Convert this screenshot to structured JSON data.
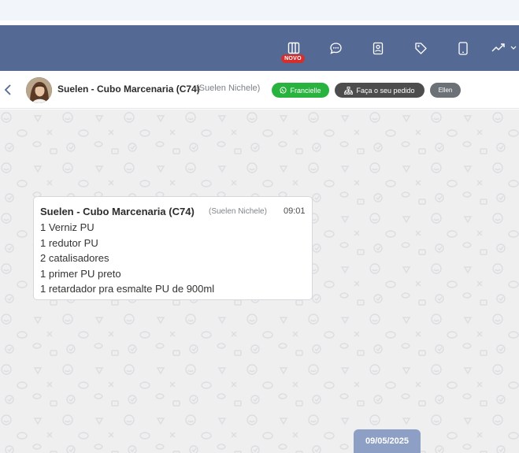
{
  "toolbar": {
    "icons": [
      "columns-icon",
      "chat-bubble-icon",
      "contact-book-icon",
      "tag-icon",
      "mobile-icon",
      "trending-up-icon",
      "chevron-down-icon"
    ],
    "novo_badge": "NOVO"
  },
  "chat_header": {
    "contact_name": "Suelen - Cubo Marcenaria (C74)",
    "contact_subname": "(Suelen Nichele)",
    "tags": [
      {
        "label": "Francielle",
        "icon": "whatsapp-icon",
        "color": "#28b33f"
      },
      {
        "label": "Faça o seu pedido",
        "icon": "org-chart-icon",
        "color": "#4d4d4d"
      },
      {
        "label": "Ellen",
        "color": "#6c7077"
      }
    ]
  },
  "message": {
    "sender": "Suelen - Cubo Marcenaria (C74)",
    "sender_sub": "(Suelen Nichele)",
    "time": "09:01",
    "lines": [
      "1 Verniz PU",
      "1 redutor PU",
      "2 catalisadores",
      "1 primer PU preto",
      "1 retardador pra esmalte PU de 900ml"
    ]
  },
  "date_separator": "09/05/2025",
  "colors": {
    "topbar": "#546a95",
    "chat_background": "#efeff0",
    "date_chip": "#8d9fc4",
    "novo_badge": "#d32f2f"
  }
}
